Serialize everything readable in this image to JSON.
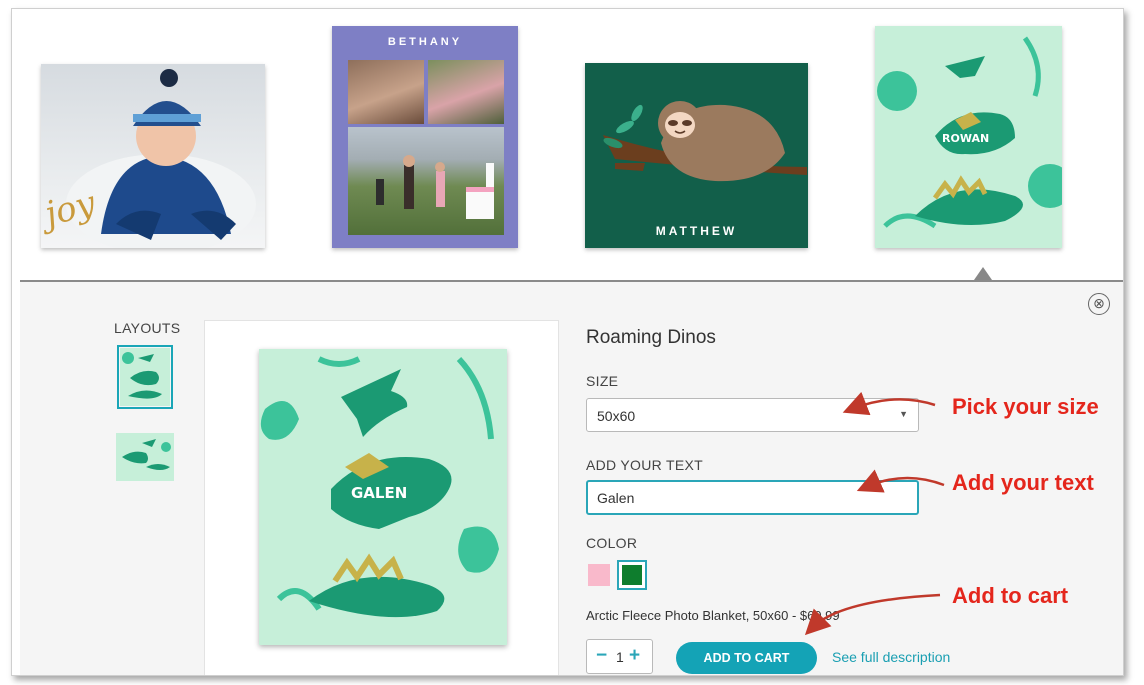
{
  "gallery": {
    "thumb1": {
      "script_text": "joy"
    },
    "thumb2": {
      "name": "BETHANY"
    },
    "thumb3": {
      "name": "MATTHEW"
    },
    "thumb4": {
      "name": "ROWAN"
    }
  },
  "panel": {
    "close_icon": "⊗",
    "layouts_label": "LAYOUTS",
    "preview_name": "GALEN",
    "product_title": "Roaming Dinos",
    "size": {
      "label": "SIZE",
      "selected": "50x60",
      "arrow": "▼"
    },
    "text_field": {
      "label": "ADD YOUR TEXT",
      "value": "Galen"
    },
    "color": {
      "label": "COLOR",
      "options": [
        "#f9b9cb",
        "#0e7d2d"
      ],
      "selected": "#0e7d2d"
    },
    "description": "Arctic Fleece Photo Blanket, 50x60 - $69.99",
    "quantity": {
      "minus": "−",
      "value": "1",
      "plus": "+"
    },
    "add_to_cart": "ADD TO CART",
    "see_full_description": "See full description"
  },
  "annotations": {
    "pick_size": "Pick your size",
    "add_text": "Add your text",
    "add_cart": "Add to cart",
    "color": "#e4261c"
  },
  "theme": {
    "accent": "#14a3b6",
    "mint": "#c6efd9",
    "dino_green": "#1b9a73"
  }
}
